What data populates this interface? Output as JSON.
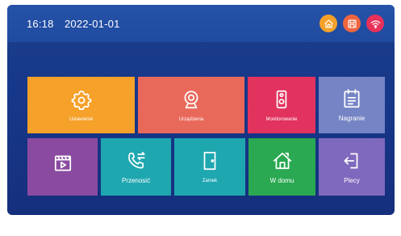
{
  "status_bar": {
    "time": "16:18",
    "date": "2022-01-01",
    "icons": [
      {
        "name": "home-mode-icon",
        "color": "#f5a12a"
      },
      {
        "name": "save-card-icon",
        "color": "#f0653e"
      },
      {
        "name": "wifi-icon",
        "color": "#e8315a"
      }
    ]
  },
  "tiles": [
    {
      "id": "ustawienie",
      "label": "Ustawienie",
      "icon": "settings-gear-icon",
      "color": "#f5a12a"
    },
    {
      "id": "urzadzenia",
      "label": "Urządzenia",
      "icon": "webcam-icon",
      "color": "#e8695a"
    },
    {
      "id": "monitorowanie",
      "label": "Monitorowanie",
      "icon": "door-station-icon",
      "color": "#e2325e"
    },
    {
      "id": "nagranie",
      "label": "Nagranie",
      "icon": "calendar-notes-icon",
      "color": "#7584c4"
    },
    {
      "id": "video",
      "label": "",
      "icon": "video-clapper-icon",
      "color": "#8a4aa0"
    },
    {
      "id": "przenosic",
      "label": "Przenosić",
      "icon": "call-transfer-icon",
      "color": "#1fa7b0"
    },
    {
      "id": "zamek",
      "label": "Zamek",
      "icon": "door-icon",
      "color": "#1fa7b0"
    },
    {
      "id": "w-domu",
      "label": "W domu",
      "icon": "home-icon",
      "color": "#2aa852"
    },
    {
      "id": "plecy",
      "label": "Plecy",
      "icon": "back-exit-icon",
      "color": "#7f69be"
    }
  ]
}
